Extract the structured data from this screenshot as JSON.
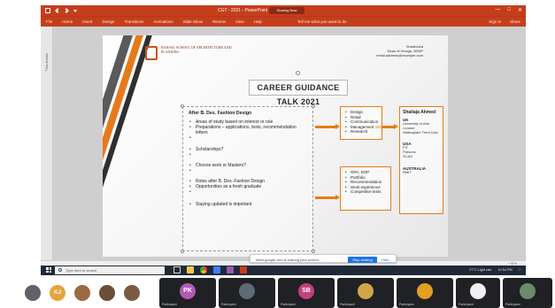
{
  "powerpoint": {
    "window_title": "CGT - 2021 - PowerPoint",
    "sharing_badge": "Sharing Now",
    "window_controls": [
      "—",
      "□",
      "✕"
    ],
    "ribbon_tabs": [
      "File",
      "Home",
      "Insert",
      "Design",
      "Transitions",
      "Animations",
      "Slide Show",
      "Review",
      "View",
      "Help"
    ],
    "tell_me": "Tell me what you want to do",
    "ribbon_right": [
      "Sign in",
      "Share"
    ],
    "thumbnails_label": "Thumbnails",
    "zoom": "+ 91%"
  },
  "slide": {
    "logo_text": "BANSAL SCHOOL OF ARCHITECTURE AND PLANNING",
    "speaker": [
      "Shailendra",
      "Dean of Design, BSAP",
      "email.address@example.com"
    ],
    "title": "CAREER GUIDANCE TALK 2021",
    "main_heading": "After B. Des. Fashion Design",
    "main_bullets": [
      "Areas of study based on interest or role",
      "Preparations – applications, tests, recommendation letters",
      "",
      "Scholarships?",
      "",
      "Choose work or Masters?",
      "",
      "Roles after B. Des. Fashion Design",
      "Opportunities as a fresh graduate",
      "",
      "Staying updated is important"
    ],
    "box_roles": [
      "Design",
      "Retail",
      "Communication",
      "Management",
      "Research"
    ],
    "box_apply": [
      "GPA, SOP",
      "Portfolio",
      "Recommendation",
      "Work experience",
      "Competitive tests"
    ],
    "right_name": "Shailaja Ahmed",
    "right_sections": [
      {
        "head": "UK",
        "lines": [
          "University of Arts London",
          "Nottingham Trent Univ."
        ]
      },
      {
        "head": "USA",
        "lines": [
          "FIT",
          "Parsons",
          "SCAD"
        ]
      },
      {
        "head": "AUSTRALIA",
        "lines": [
          "RMIT"
        ]
      }
    ]
  },
  "toast": {
    "message": "meet.google.com is sharing your screen.",
    "stop_label": "Stop sharing",
    "hide_label": "Hide"
  },
  "taskbar": {
    "search_placeholder": "Type here to search",
    "weather": "27°C Light rain",
    "time": "10:54 PM"
  },
  "participants": [
    {
      "initials": "",
      "color": "#5f6368",
      "name": ""
    },
    {
      "initials": "KJ",
      "color": "#e5a53a",
      "name": ""
    },
    {
      "initials": "",
      "color": "#9a6b3f",
      "name": ""
    },
    {
      "initials": "",
      "color": "#6b4f3a",
      "name": ""
    },
    {
      "initials": "",
      "color": "#7a5a45",
      "name": ""
    },
    {
      "initials": "PK",
      "color": "#b05ab3",
      "name": "Participant"
    },
    {
      "initials": "",
      "color": "#5d6a78",
      "name": "Participant"
    },
    {
      "initials": "",
      "color": "#3b3f45",
      "name": "Participant"
    },
    {
      "initials": "SB",
      "color": "#c23f7d",
      "name": "Participant"
    },
    {
      "initials": "",
      "color": "#d1a64a",
      "name": "Participant"
    },
    {
      "initials": "",
      "color": "#e0a020",
      "name": "Participant"
    },
    {
      "initials": "",
      "color": "#f0f0f0",
      "name": "Participant"
    },
    {
      "initials": "",
      "color": "#6b8c6b",
      "name": "Participant"
    }
  ],
  "colors": {
    "ppt_red": "#c43e1c",
    "accent_orange": "#e67b13",
    "meet_blue": "#1a73e8",
    "taskbar": "#1f2937"
  }
}
